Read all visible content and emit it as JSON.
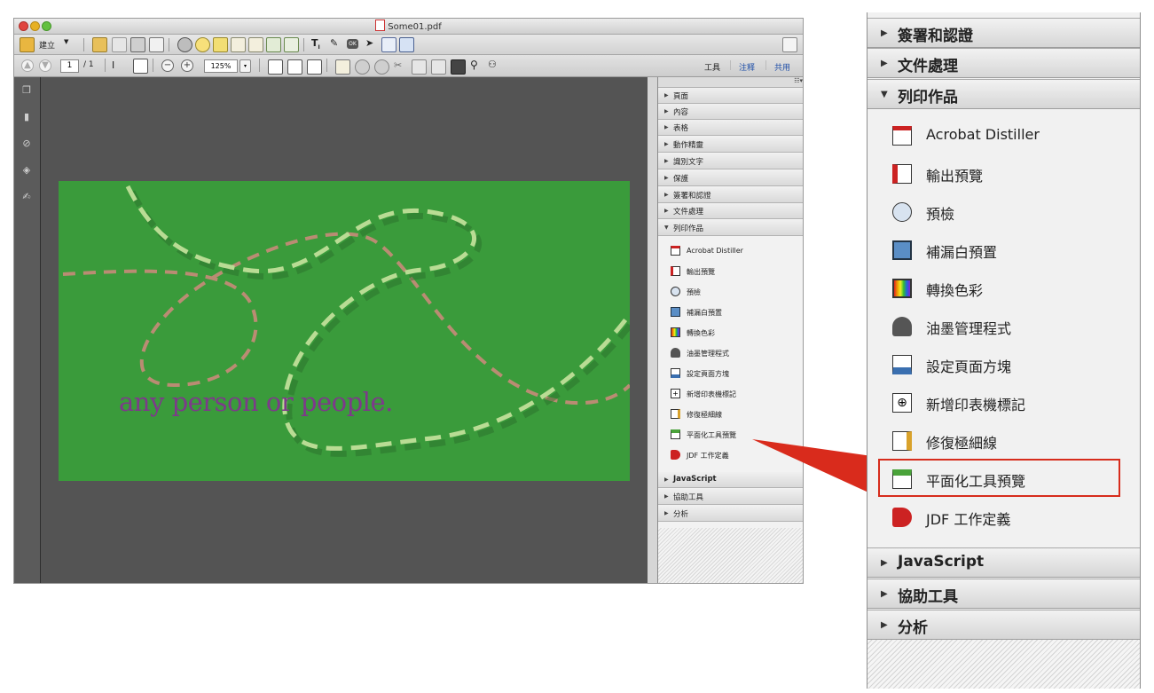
{
  "window": {
    "title": "Some01.pdf",
    "create_label": "建立",
    "page_current": "1",
    "page_total": "/ 1",
    "zoom": "125%",
    "right_tools": [
      "工具",
      "注释",
      "共用"
    ]
  },
  "document": {
    "text": "any person or people."
  },
  "pane": {
    "sections_top": [
      "頁面",
      "內容",
      "表格",
      "動作精靈",
      "識別文字",
      "保護",
      "簽署和認證",
      "文件處理"
    ],
    "open_section": "列印作品",
    "items": [
      {
        "label": "Acrobat Distiller",
        "icon": "acrobat-distiller-icon"
      },
      {
        "label": "輸出預覽",
        "icon": "output-preview-icon"
      },
      {
        "label": "預檢",
        "icon": "preflight-icon"
      },
      {
        "label": "補漏白預置",
        "icon": "trap-presets-icon"
      },
      {
        "label": "轉換色彩",
        "icon": "convert-colors-icon"
      },
      {
        "label": "油墨管理程式",
        "icon": "ink-manager-icon"
      },
      {
        "label": "設定頁面方塊",
        "icon": "set-page-boxes-icon"
      },
      {
        "label": "新增印表機標記",
        "icon": "add-printer-marks-icon"
      },
      {
        "label": "修復極細線",
        "icon": "fix-hairlines-icon"
      },
      {
        "label": "平面化工具預覽",
        "icon": "flattener-preview-icon"
      },
      {
        "label": "JDF 工作定義",
        "icon": "jdf-job-definitions-icon"
      }
    ],
    "sections_bottom": [
      "JavaScript",
      "協助工具",
      "分析"
    ]
  },
  "zoomed_pane": {
    "sections_top": [
      "簽署和認證",
      "文件處理"
    ],
    "open_section": "列印作品",
    "highlighted_item": "平面化工具預覽",
    "sections_bottom": [
      "JavaScript",
      "協助工具",
      "分析"
    ]
  },
  "colors": {
    "page_green": "#3a9b3b",
    "text_purple": "#7d3a8a",
    "highlight_red": "#d72c1c",
    "workspace_gray": "#545454"
  }
}
